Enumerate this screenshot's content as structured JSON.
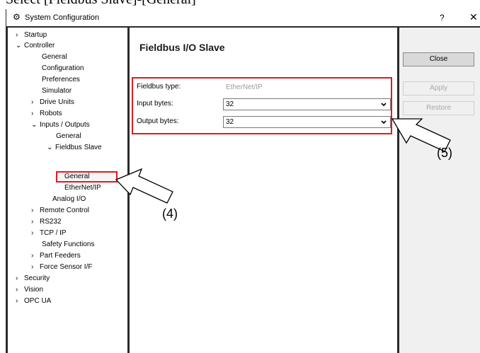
{
  "caption": "Select [Fieldbus Slave]-[General]",
  "window": {
    "title": "System Configuration",
    "help": "?",
    "close": "✕"
  },
  "tree": {
    "items": [
      {
        "label": "Startup",
        "chev": "›"
      },
      {
        "label": "Controller",
        "chev": "⌄"
      },
      {
        "label": "General",
        "chev": ""
      },
      {
        "label": "Configuration",
        "chev": ""
      },
      {
        "label": "Preferences",
        "chev": ""
      },
      {
        "label": "Simulator",
        "chev": ""
      },
      {
        "label": "Drive Units",
        "chev": "›"
      },
      {
        "label": "Robots",
        "chev": "›"
      },
      {
        "label": "Inputs / Outputs",
        "chev": "⌄"
      },
      {
        "label": "General",
        "chev": ""
      },
      {
        "label": "Fieldbus Slave",
        "chev": "⌄"
      },
      {
        "label": "General",
        "chev": ""
      },
      {
        "label": "EtherNet/IP",
        "chev": ""
      },
      {
        "label": "Analog I/O",
        "chev": ""
      },
      {
        "label": "Remote Control",
        "chev": "›"
      },
      {
        "label": "RS232",
        "chev": "›"
      },
      {
        "label": "TCP / IP",
        "chev": "›"
      },
      {
        "label": "Safety Functions",
        "chev": ""
      },
      {
        "label": "Part Feeders",
        "chev": "›"
      },
      {
        "label": "Force Sensor I/F",
        "chev": "›"
      },
      {
        "label": "Security",
        "chev": "›"
      },
      {
        "label": "Vision",
        "chev": "›"
      },
      {
        "label": "OPC UA",
        "chev": "›"
      }
    ]
  },
  "content": {
    "title": "Fieldbus I/O Slave",
    "fields": {
      "fieldbus_type": {
        "label": "Fieldbus type:",
        "value": "EtherNet/IP"
      },
      "input_bytes": {
        "label": "Input bytes:",
        "value": "32"
      },
      "output_bytes": {
        "label": "Output bytes:",
        "value": "32"
      }
    }
  },
  "buttons": {
    "close": "Close",
    "apply": "Apply",
    "restore": "Restore"
  },
  "callouts": {
    "four": "(4)",
    "five": "(5)"
  },
  "colors": {
    "highlight": "#e0191f",
    "window_bg": "#f0f0f0"
  }
}
